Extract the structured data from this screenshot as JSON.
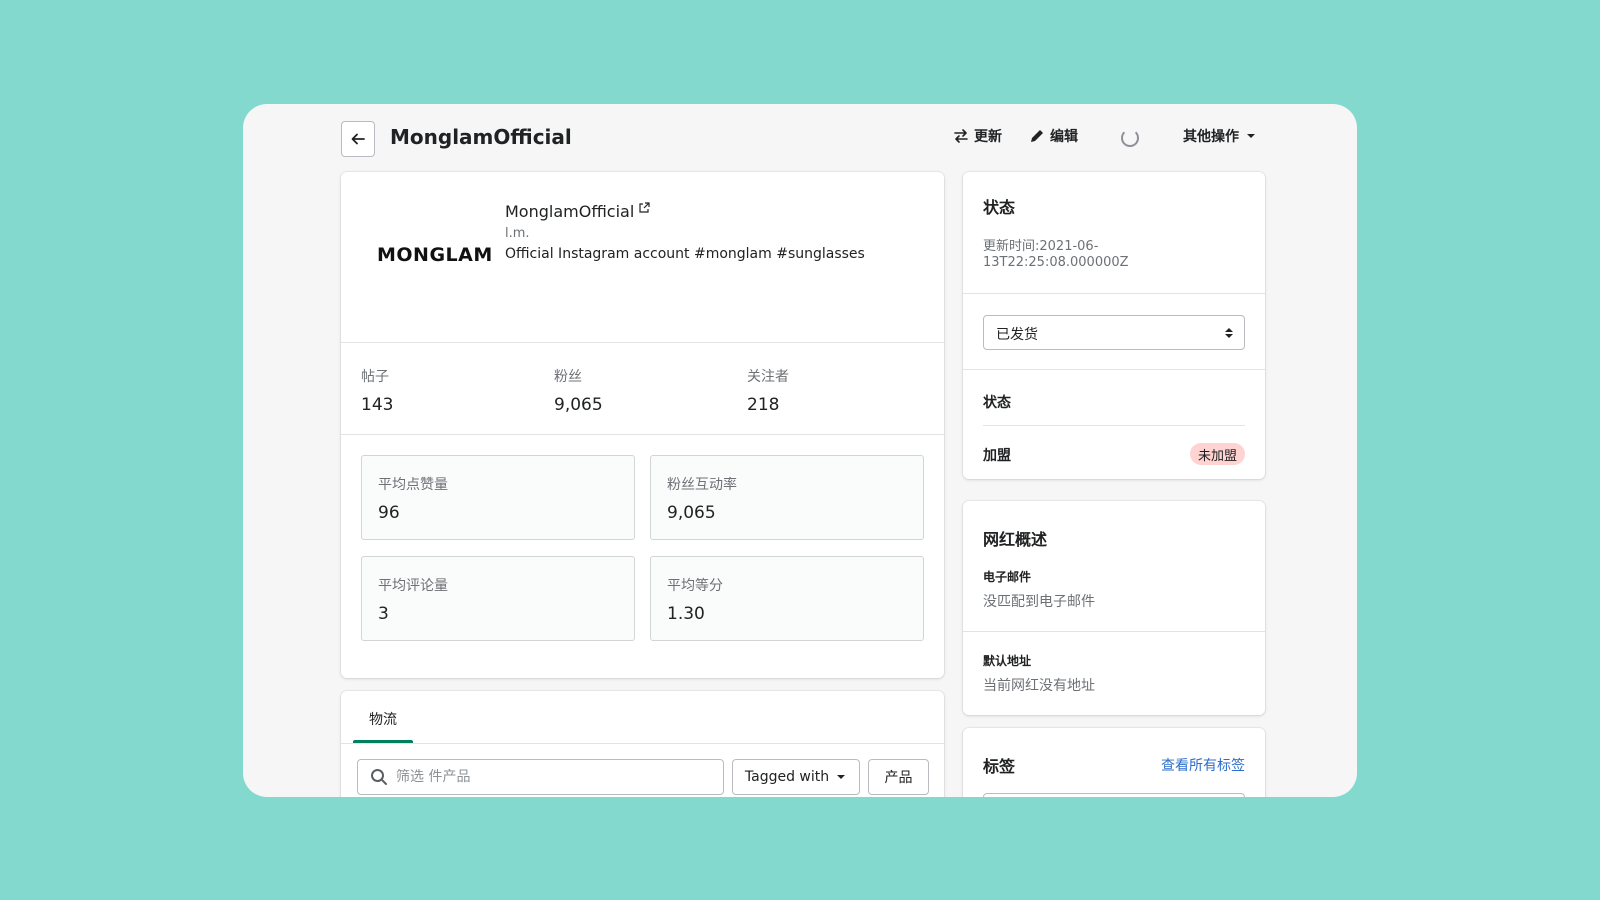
{
  "header": {
    "title": "MonglamOfficial",
    "actions": {
      "update": "更新",
      "edit": "编辑",
      "more": "其他操作"
    }
  },
  "profile": {
    "logo_text": "MONGLAM",
    "name": "MonglamOfficial",
    "handle": "l.m.",
    "bio": "Official Instagram account #monglam #sunglasses"
  },
  "stats": [
    {
      "label": "帖子",
      "value": "143"
    },
    {
      "label": "粉丝",
      "value": "9,065"
    },
    {
      "label": "关注者",
      "value": "218"
    }
  ],
  "metrics": [
    {
      "label": "平均点赞量",
      "value": "96"
    },
    {
      "label": "粉丝互动率",
      "value": "9,065"
    },
    {
      "label": "平均评论量",
      "value": "3"
    },
    {
      "label": "平均等分",
      "value": "1.30"
    }
  ],
  "logistics": {
    "tab": "物流",
    "search_placeholder": "筛选 件产品",
    "tagged_with": "Tagged with",
    "product_button": "产品"
  },
  "status_card": {
    "title": "状态",
    "updated_line1": "更新时间:2021-06-",
    "updated_line2": "13T22:25:08.000000Z",
    "select_value": "已发货",
    "status_label": "状态",
    "join_label": "加盟",
    "join_badge": "未加盟"
  },
  "overview_card": {
    "title": "网红概述",
    "email_label": "电子邮件",
    "email_value": "没匹配到电子邮件",
    "address_label": "默认地址",
    "address_value": "当前网红没有地址"
  },
  "tags_card": {
    "title": "标签",
    "view_all": "查看所有标签"
  },
  "colors": {
    "background": "#84d9cf",
    "accent": "#008060",
    "link": "#2c6ecb",
    "badge": "#fed3d1"
  }
}
